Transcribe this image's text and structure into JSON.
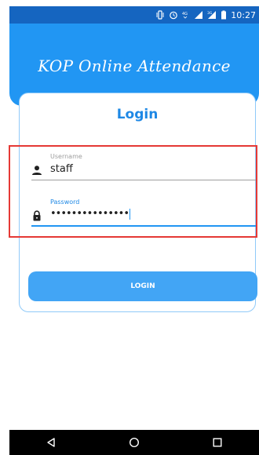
{
  "status_bar": {
    "time": "10:27",
    "icons": [
      "vibrate-icon",
      "alarm-icon",
      "signal-4g-icon",
      "wifi-signal-icon",
      "signal-3g-icon",
      "battery-icon"
    ]
  },
  "header": {
    "title": "KOP Online Attendance"
  },
  "login": {
    "title": "Login",
    "username_label": "Username",
    "username_value": "staff",
    "password_label": "Password",
    "password_value": "•••••••••••••••",
    "button_label": "LOGIN"
  },
  "navbar": {
    "icons": [
      "back-icon",
      "home-icon",
      "recents-icon"
    ]
  },
  "colors": {
    "primary": "#2196f3",
    "status_bar": "#1565c0",
    "highlight": "#e53935"
  }
}
